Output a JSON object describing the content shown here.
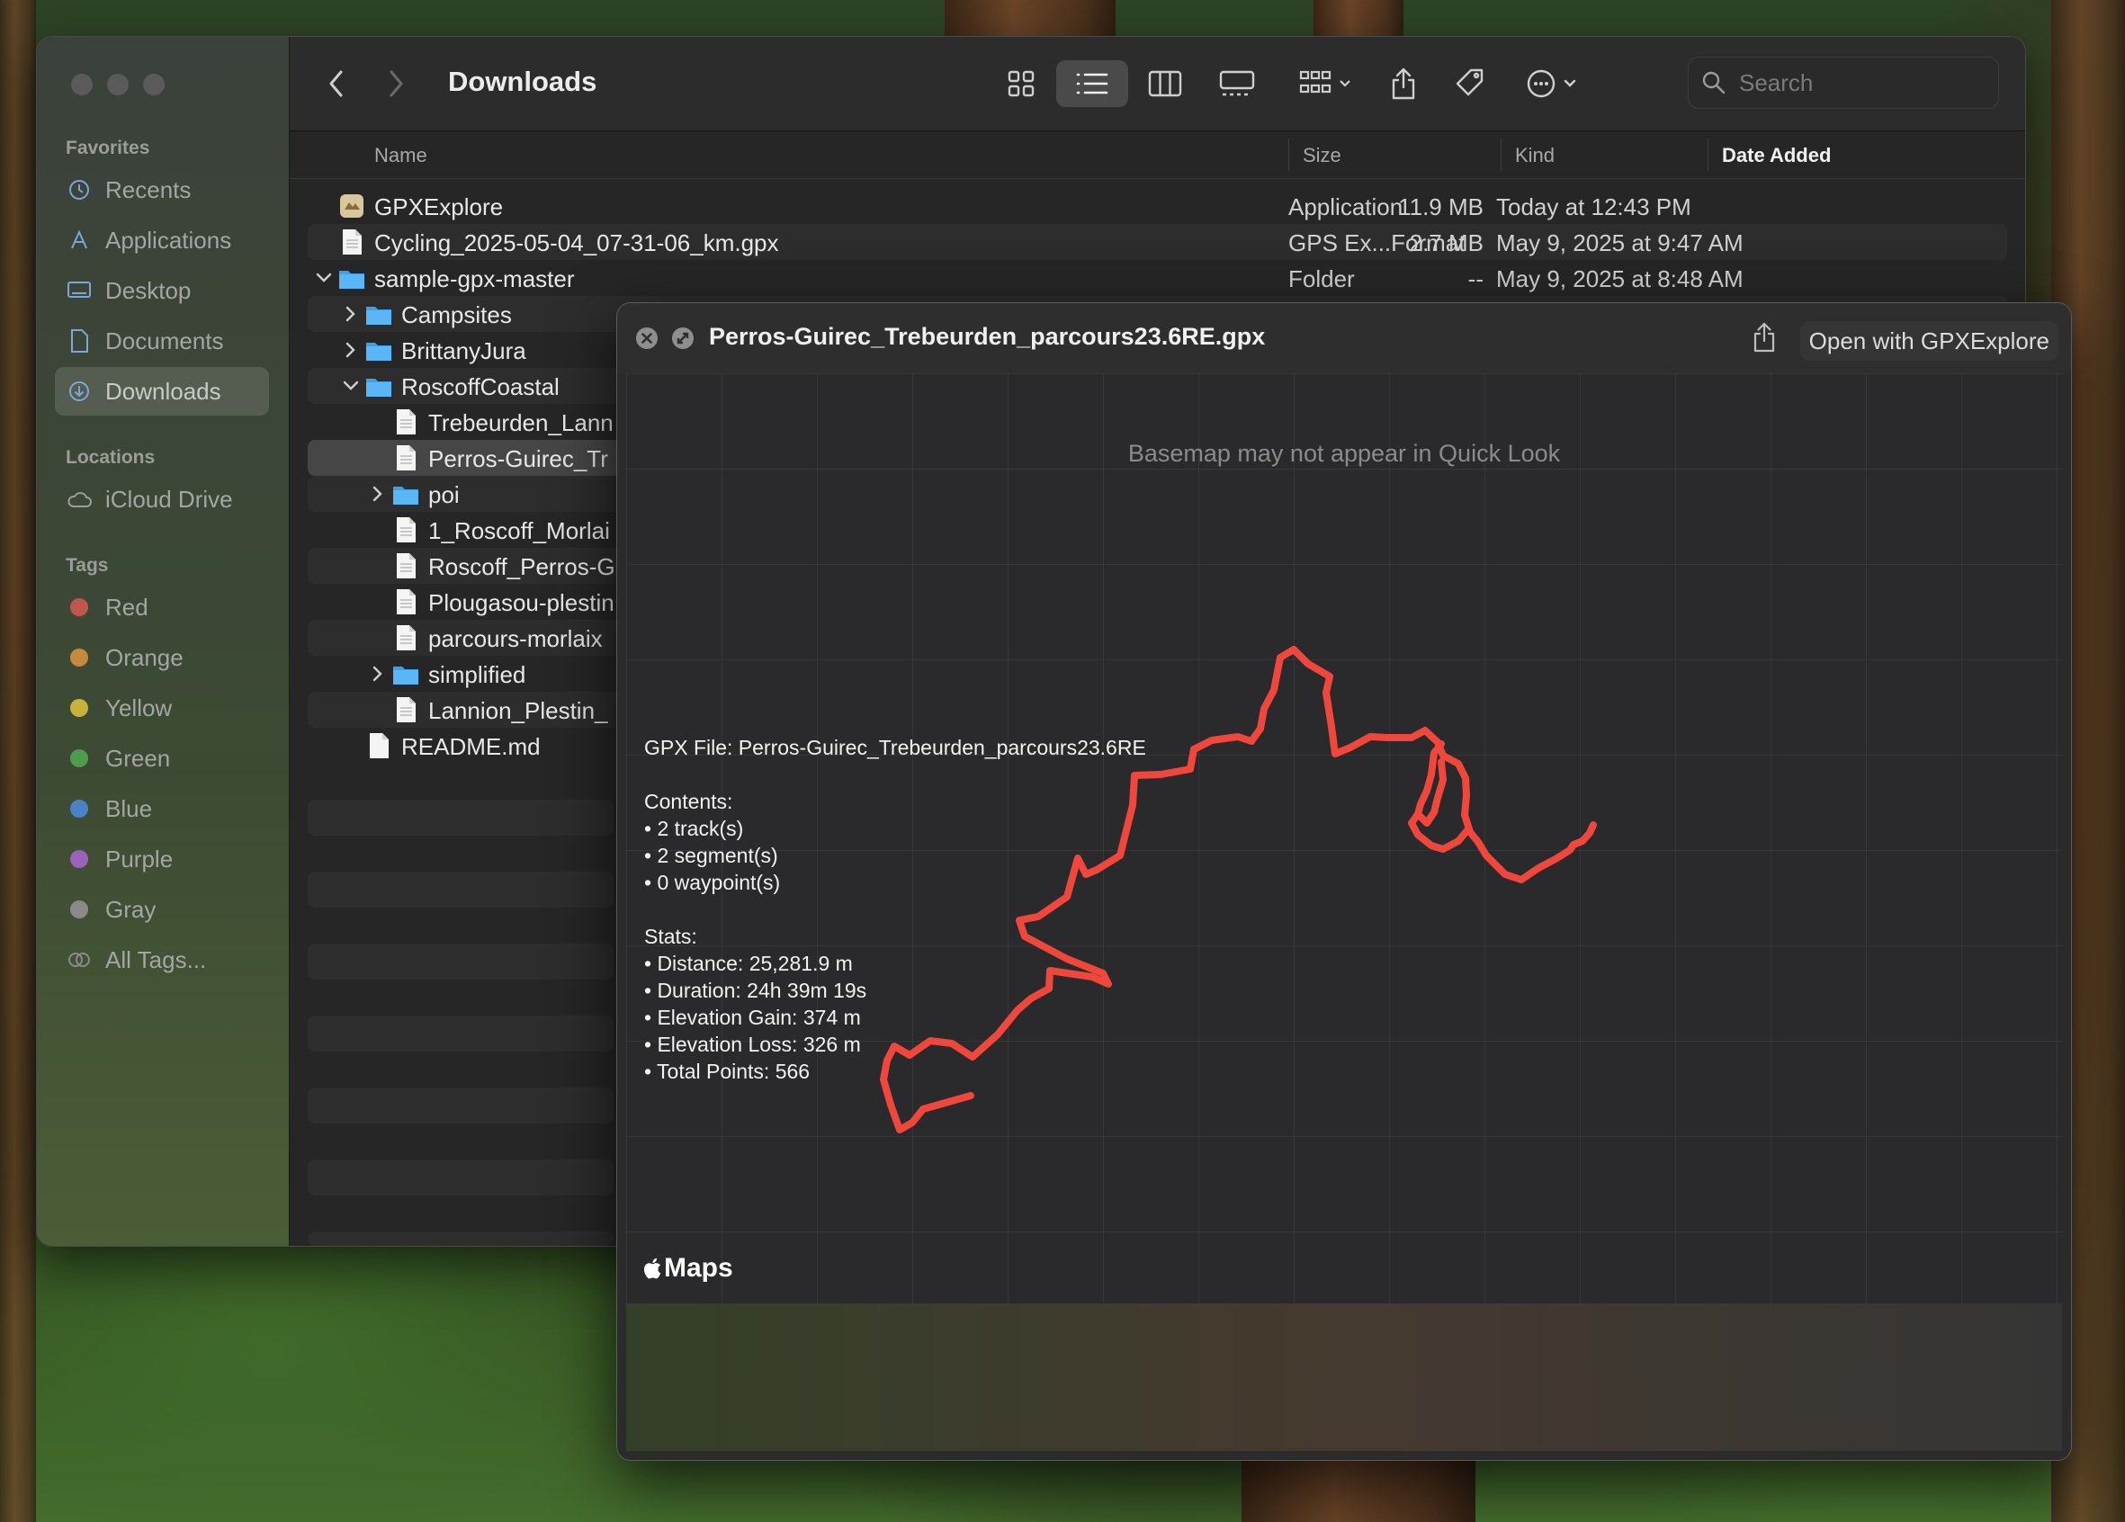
{
  "finder": {
    "title": "Downloads",
    "search_placeholder": "Search",
    "sidebar": {
      "favorites_header": "Favorites",
      "favorites": [
        {
          "label": "Recents",
          "icon": "clock-icon"
        },
        {
          "label": "Applications",
          "icon": "applications-icon"
        },
        {
          "label": "Desktop",
          "icon": "desktop-icon"
        },
        {
          "label": "Documents",
          "icon": "document-icon"
        },
        {
          "label": "Downloads",
          "icon": "download-icon",
          "selected": true
        }
      ],
      "locations_header": "Locations",
      "locations": [
        {
          "label": "iCloud Drive",
          "icon": "cloud-icon"
        }
      ],
      "tags_header": "Tags",
      "tags": [
        {
          "label": "Red",
          "color": "#c2564c"
        },
        {
          "label": "Orange",
          "color": "#c68a3d"
        },
        {
          "label": "Yellow",
          "color": "#c8b23e"
        },
        {
          "label": "Green",
          "color": "#4f9c4e"
        },
        {
          "label": "Blue",
          "color": "#4a82c8"
        },
        {
          "label": "Purple",
          "color": "#9a62b8"
        },
        {
          "label": "Gray",
          "color": "#8a8a8a"
        },
        {
          "label": "All Tags...",
          "color": ""
        }
      ]
    },
    "columns": {
      "name": "Name",
      "size": "Size",
      "kind": "Kind",
      "date": "Date Added"
    },
    "files": [
      {
        "name": "GPXExplore",
        "size": "11.9 MB",
        "kind": "Application",
        "date": "Today at 12:43 PM",
        "icon": "app-icon"
      },
      {
        "name": "Cycling_2025-05-04_07-31-06_km.gpx",
        "size": "2.7 MB",
        "kind": "GPS Ex...Format",
        "date": "May 9, 2025 at 9:47 AM",
        "icon": "document-icon"
      },
      {
        "name": "sample-gpx-master",
        "size": "--",
        "kind": "Folder",
        "date": "May 9, 2025 at 8:48 AM",
        "icon": "folder-icon",
        "expanded": true
      },
      {
        "name": "Campsites",
        "icon": "folder-icon"
      },
      {
        "name": "BrittanyJura",
        "icon": "folder-icon"
      },
      {
        "name": "RoscoffCoastal",
        "icon": "folder-icon",
        "expanded": true
      },
      {
        "name": "Trebeurden_Lann",
        "icon": "document-icon"
      },
      {
        "name": "Perros-Guirec_Tr",
        "icon": "document-icon",
        "selected": true
      },
      {
        "name": "poi",
        "icon": "folder-icon"
      },
      {
        "name": "1_Roscoff_Morlai",
        "icon": "document-icon"
      },
      {
        "name": "Roscoff_Perros-G",
        "icon": "document-icon"
      },
      {
        "name": "Plougasou-plestin",
        "icon": "document-icon"
      },
      {
        "name": "parcours-morlaix",
        "icon": "document-icon"
      },
      {
        "name": "simplified",
        "icon": "folder-icon"
      },
      {
        "name": "Lannion_Plestin_",
        "icon": "document-icon"
      },
      {
        "name": "README.md",
        "icon": "document-icon"
      }
    ]
  },
  "quicklook": {
    "title": "Perros-Guirec_Trebeurden_parcours23.6RE.gpx",
    "open_button": "Open with GPXExplore",
    "map_note": "Basemap may not appear in Quick Look",
    "maps_label": "Maps",
    "route_color": "#f0473d",
    "info": {
      "file_line": "GPX File: Perros-Guirec_Trebeurden_parcours23.6RE",
      "contents_header": "Contents:",
      "contents": [
        "• 2 track(s)",
        "• 2 segment(s)",
        "• 0 waypoint(s)"
      ],
      "stats_header": "Stats:",
      "stats": [
        "• Distance: 25,281.9 m",
        "• Duration: 24h 39m 19s",
        "• Elevation Gain: 374 m",
        "• Elevation Loss: 326 m",
        "• Total Points: 566"
      ]
    }
  }
}
